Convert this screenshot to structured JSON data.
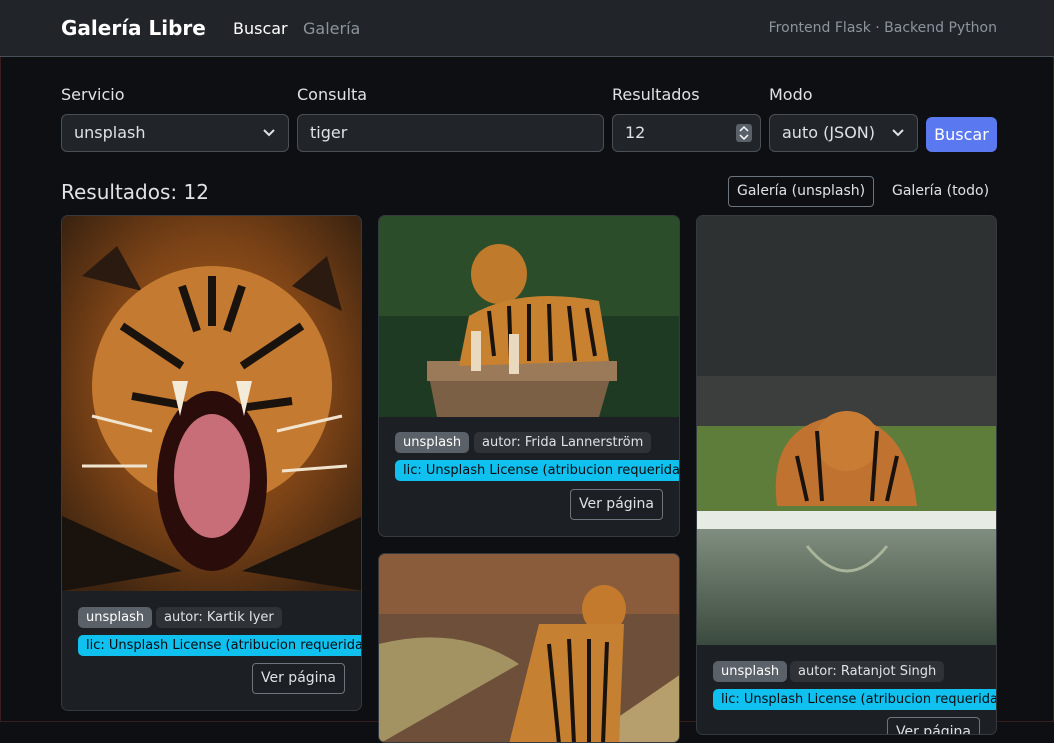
{
  "navbar": {
    "brand": "Galería Libre",
    "links": [
      "Buscar",
      "Galería"
    ],
    "right_text": "Frontend Flask · Backend Python"
  },
  "form": {
    "servicio": {
      "label": "Servicio",
      "value": "unsplash"
    },
    "consulta": {
      "label": "Consulta",
      "value": "tiger"
    },
    "resultados": {
      "label": "Resultados",
      "value": "12"
    },
    "modo": {
      "label": "Modo",
      "value": "auto (JSON)"
    },
    "submit_label": "Buscar"
  },
  "results": {
    "title": "Resultados: 12",
    "gallery_buttons": [
      "Galería (unsplash)",
      "Galería (todo)"
    ]
  },
  "cards": [
    {
      "source": "unsplash",
      "author": "autor: Kartik Iyer",
      "license": "lic: Unsplash License (atribucion requerida)",
      "link": "Ver página"
    },
    {
      "source": "unsplash",
      "author": "autor: Frida Lannerström",
      "license": "lic: Unsplash License (atribucion requerida)",
      "link": "Ver página"
    },
    {
      "source": "unsplash",
      "author": "autor: Ratanjot Singh",
      "license": "lic: Unsplash License (atribucion requerida)",
      "link": "Ver página"
    }
  ],
  "colors": {
    "accent": "#5a78f0",
    "license_badge": "#10c0ee",
    "navbar": "#212529"
  }
}
